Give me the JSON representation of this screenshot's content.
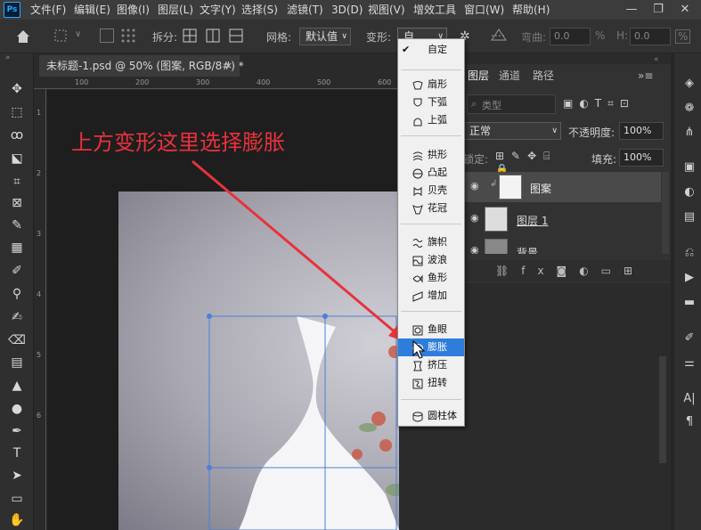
{
  "app": {
    "logo": "Ps"
  },
  "menu": [
    "文件(F)",
    "编辑(E)",
    "图像(I)",
    "图层(L)",
    "文字(Y)",
    "选择(S)",
    "滤镜(T)",
    "3D(D)",
    "视图(V)",
    "增效工具",
    "窗口(W)",
    "帮助(H)"
  ],
  "window_controls": {
    "minimize": "—",
    "restore": "❐",
    "close": "✕"
  },
  "options": {
    "split_label": "拆分:",
    "grid_label": "网格:",
    "grid_value": "默认值",
    "warp_label": "变形:",
    "warp_value": "自...",
    "bend_label": "弯曲:",
    "bend_value": "0.0",
    "bend_unit": "%",
    "h_label": "H:",
    "h_value": "0.0",
    "h_unit": "%"
  },
  "document": {
    "tab_title": "未标题-1.psd @ 50% (图案, RGB/8#) *",
    "close": "×"
  },
  "rulers": {
    "top": [
      "100",
      "200",
      "300",
      "400",
      "500",
      "600"
    ],
    "left": [
      "1",
      "2",
      "3",
      "4",
      "5",
      "6"
    ]
  },
  "layers": {
    "tabs": [
      "图层",
      "通道",
      "路径"
    ],
    "search_placeholder": "类型",
    "blend_mode": "正常",
    "opacity_label": "不透明度:",
    "opacity_value": "100%",
    "lock_label": "锁定:",
    "fill_label": "填充:",
    "fill_value": "100%",
    "items": [
      {
        "name": "图案"
      },
      {
        "name": "图层 1"
      },
      {
        "name": "背景"
      }
    ]
  },
  "warp_menu": {
    "items": [
      {
        "label": "自定",
        "checked": true
      },
      {
        "label": "扇形"
      },
      {
        "label": "下弧"
      },
      {
        "label": "上弧"
      },
      {
        "label": "拱形"
      },
      {
        "label": "凸起"
      },
      {
        "label": "贝壳"
      },
      {
        "label": "花冠"
      },
      {
        "label": "旗帜"
      },
      {
        "label": "波浪"
      },
      {
        "label": "鱼形"
      },
      {
        "label": "增加"
      },
      {
        "label": "鱼眼"
      },
      {
        "label": "膨胀",
        "selected": true
      },
      {
        "label": "挤压"
      },
      {
        "label": "扭转"
      },
      {
        "label": "圆柱体"
      }
    ]
  },
  "annotation": {
    "text": "上方变形这里选择膨胀",
    "color": "#e8323c"
  },
  "colors": {
    "selection": "#2f7ddb",
    "annotation": "#e8323c",
    "transform_box": "#4a7fd8"
  }
}
